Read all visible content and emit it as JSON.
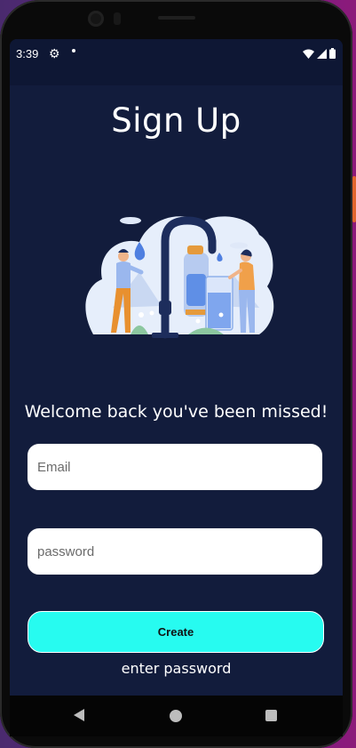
{
  "status_bar": {
    "time": "3:39",
    "icons": [
      "gear-icon",
      "notification-dot-icon",
      "wifi-icon",
      "signal-icon",
      "battery-icon"
    ]
  },
  "page": {
    "title": "Sign Up",
    "welcome": "Welcome back you've been missed!"
  },
  "form": {
    "email_placeholder": "Email",
    "password_placeholder": "password",
    "create_label": "Create",
    "hint": "enter password"
  },
  "nav_bar": {
    "icons": [
      "back-icon",
      "home-icon",
      "recent-apps-icon"
    ]
  },
  "colors": {
    "background": "#121c3c",
    "button": "#27fbf0",
    "text": "#ffffff"
  }
}
